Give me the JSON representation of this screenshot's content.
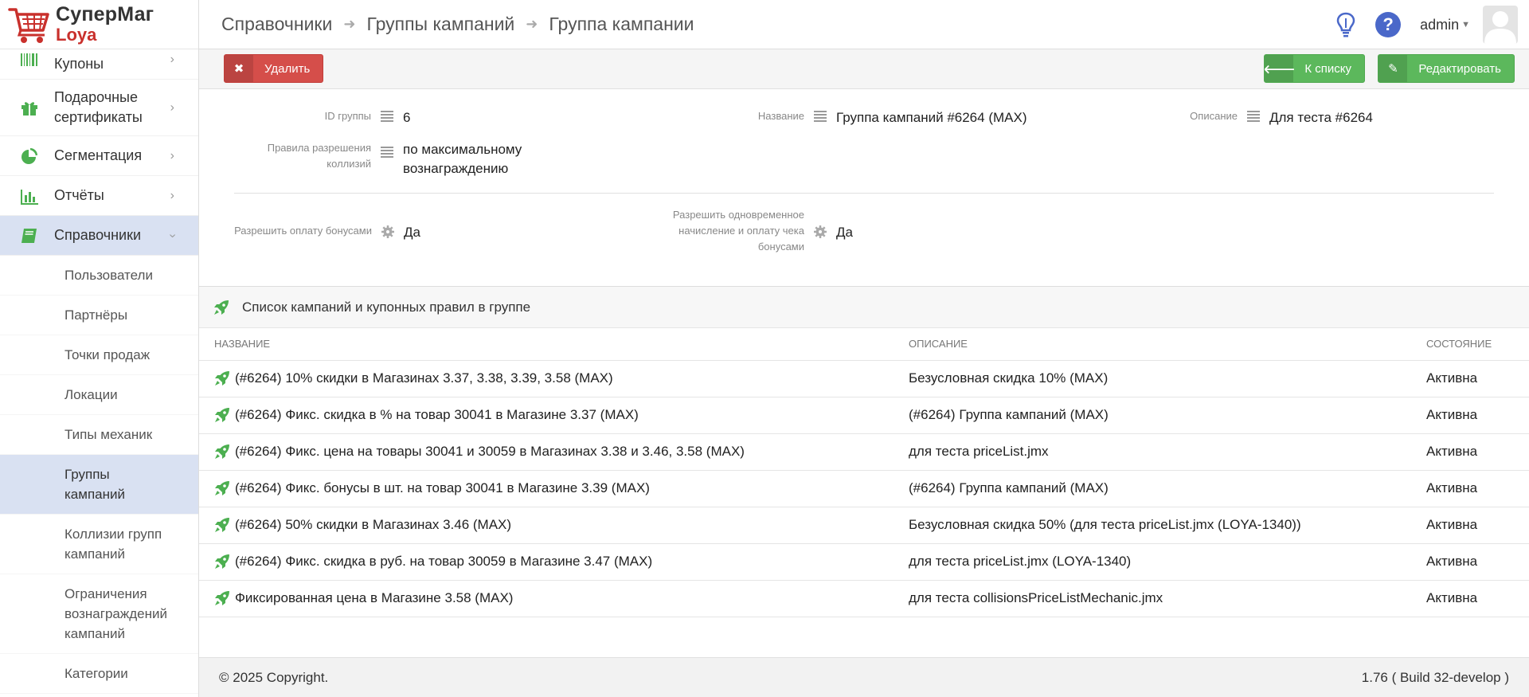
{
  "logo": {
    "title": "СуперМаг",
    "subtitle": "Loya"
  },
  "sidebar": {
    "items": [
      {
        "label": "Купоны",
        "icon": "barcode-icon"
      },
      {
        "label": "Подарочные сертификаты",
        "icon": "gift-icon"
      },
      {
        "label": "Сегментация",
        "icon": "pie-chart-icon"
      },
      {
        "label": "Отчёты",
        "icon": "bar-chart-icon"
      },
      {
        "label": "Справочники",
        "icon": "book-icon"
      }
    ],
    "subitems": [
      "Пользователи",
      "Партнёры",
      "Точки продаж",
      "Локации",
      "Типы механик",
      "Группы кампаний",
      "Коллизии групп кампаний",
      "Ограничения вознаграждений кампаний",
      "Категории"
    ]
  },
  "header": {
    "breadcrumbs": [
      "Справочники",
      "Группы кампаний",
      "Группа кампании"
    ],
    "user": "admin"
  },
  "toolbar": {
    "delete_label": "Удалить",
    "list_label": "К списку",
    "edit_label": "Редактировать"
  },
  "details": {
    "group_id_label": "ID группы",
    "group_id": "6",
    "name_label": "Название",
    "name": "Группа кампаний #6264 (MAX)",
    "desc_label": "Описание",
    "desc": "Для теста #6264",
    "collision_label": "Правила разрешения коллизий",
    "collision": "по максимальному вознаграждению",
    "bonus_pay_label": "Разрешить оплату бонусами",
    "bonus_pay": "Да",
    "simultaneous_label": "Разрешить одновременное начисление и оплату чека бонусами",
    "simultaneous": "Да"
  },
  "campaigns": {
    "title": "Список кампаний и купонных правил в группе",
    "columns": [
      "НАЗВАНИЕ",
      "ОПИСАНИЕ",
      "СОСТОЯНИЕ"
    ],
    "rows": [
      {
        "name": "(#6264) 10% скидки в Магазинах 3.37, 3.38, 3.39, 3.58 (MAX)",
        "desc": "Безусловная скидка 10% (MAX)",
        "state": "Активна"
      },
      {
        "name": "(#6264) Фикс. скидка в % на товар 30041 в Магазине 3.37 (MAX)",
        "desc": "(#6264) Группа кампаний (MAX)",
        "state": "Активна"
      },
      {
        "name": "(#6264) Фикс. цена на товары 30041 и 30059 в Магазинах 3.38 и 3.46, 3.58 (MAX)",
        "desc": "для теста priceList.jmx",
        "state": "Активна"
      },
      {
        "name": "(#6264) Фикс. бонусы в шт. на товар 30041 в Магазине 3.39 (MAX)",
        "desc": "(#6264) Группа кампаний (MAX)",
        "state": "Активна"
      },
      {
        "name": "(#6264) 50% скидки в Магазинах 3.46 (MAX)",
        "desc": "Безусловная скидка 50% (для теста priceList.jmx (LOYA-1340))",
        "state": "Активна"
      },
      {
        "name": "(#6264) Фикс. скидка в руб. на товар 30059 в Магазине 3.47 (MAX)",
        "desc": "для теста priceList.jmx (LOYA-1340)",
        "state": "Активна"
      },
      {
        "name": "Фиксированная цена в Магазине 3.58 (MAX)",
        "desc": "для теста collisionsPriceListMechanic.jmx",
        "state": "Активна"
      }
    ]
  },
  "footer": {
    "copyright": "© 2025 Copyright.",
    "version": "1.76 ( Build 32-develop )"
  },
  "colors": {
    "accent_green": "#5cb85c",
    "danger_red": "#d54e4a",
    "active_bg": "#d9e1f2",
    "icon_green": "#4caf50",
    "help_blue": "#4a68c9"
  }
}
